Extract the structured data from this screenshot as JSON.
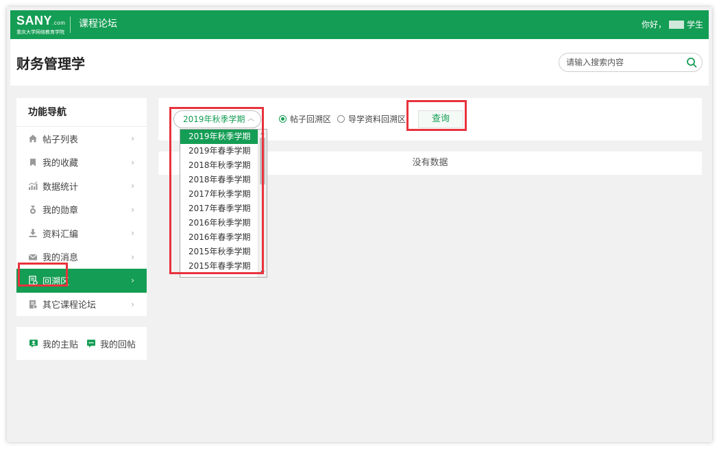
{
  "topbar": {
    "logo_main": "SANY",
    "logo_com": ".com",
    "logo_sub": "重庆大学网络教育学院",
    "forum_title": "课程论坛",
    "greeting": "你好，",
    "user_role": "学生"
  },
  "header": {
    "course_title": "财务管理学",
    "search_placeholder": "请输入搜索内容",
    "search_value": ""
  },
  "sidebar": {
    "title": "功能导航",
    "items": [
      {
        "label": "帖子列表",
        "icon": "home-icon"
      },
      {
        "label": "我的收藏",
        "icon": "bookmark-icon"
      },
      {
        "label": "数据统计",
        "icon": "stats-icon"
      },
      {
        "label": "我的勋章",
        "icon": "medal-icon"
      },
      {
        "label": "资料汇编",
        "icon": "download-icon"
      },
      {
        "label": "我的消息",
        "icon": "mail-icon"
      },
      {
        "label": "回溯区",
        "icon": "archive-icon",
        "active": true
      },
      {
        "label": "其它课程论坛",
        "icon": "forum-icon"
      }
    ],
    "chevron": "›"
  },
  "sidebar2": {
    "my_posts": "我的主贴",
    "my_replies": "我的回帖"
  },
  "filter": {
    "selected_term": "2019年秋季学期",
    "radio_posts": "帖子回溯区",
    "radio_materials": "导学资料回溯区",
    "radio_posts_checked": true,
    "query_label": "查询"
  },
  "results": {
    "empty_text": "没有数据"
  },
  "dropdown": {
    "options": [
      "2019年秋季学期",
      "2019年春季学期",
      "2018年秋季学期",
      "2018年春季学期",
      "2017年秋季学期",
      "2017年春季学期",
      "2016年秋季学期",
      "2016年春季学期",
      "2015年秋季学期",
      "2015年春季学期"
    ]
  },
  "colors": {
    "brand_green": "#149d54",
    "highlight_red": "#e8323c"
  }
}
